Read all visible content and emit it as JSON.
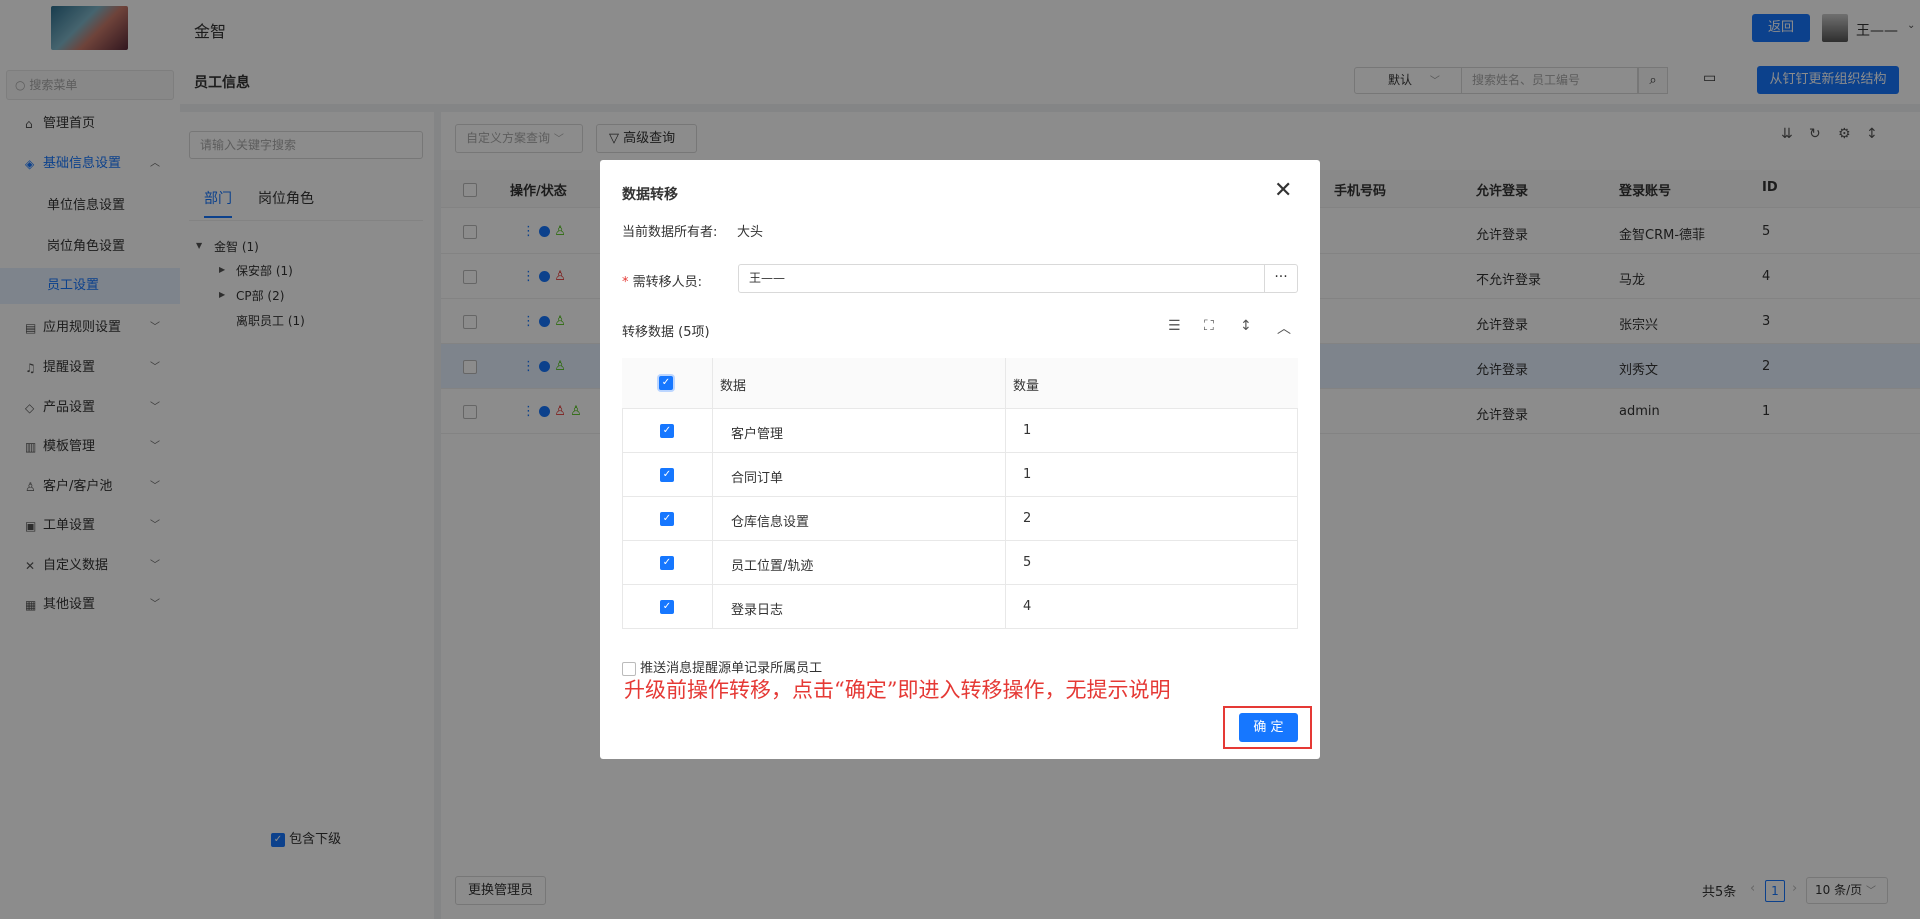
{
  "app": {
    "title": "金智",
    "back_label": "返回",
    "user_name": "王——"
  },
  "sidebar": {
    "search_placeholder": "搜索菜单",
    "items": [
      {
        "label": "管理首页",
        "icon": "home-icon",
        "glyph": "⌂"
      },
      {
        "label": "基础信息设置",
        "icon": "cube-icon",
        "glyph": "◈",
        "expanded": true
      },
      {
        "label": "应用规则设置",
        "icon": "doc-icon",
        "glyph": "▤"
      },
      {
        "label": "提醒设置",
        "icon": "bell-icon",
        "glyph": "♫"
      },
      {
        "label": "产品设置",
        "icon": "box-icon",
        "glyph": "◇"
      },
      {
        "label": "模板管理",
        "icon": "template-icon",
        "glyph": "▥"
      },
      {
        "label": "客户/客户池",
        "icon": "users-icon",
        "glyph": "♙"
      },
      {
        "label": "工单设置",
        "icon": "ticket-icon",
        "glyph": "▣"
      },
      {
        "label": "自定义数据",
        "icon": "tools-icon",
        "glyph": "✕"
      },
      {
        "label": "其他设置",
        "icon": "grid-icon",
        "glyph": "▦"
      }
    ],
    "sub_items": [
      "单位信息设置",
      "岗位角色设置",
      "员工设置"
    ]
  },
  "header": {
    "page_title": "员工信息",
    "filter_value": "默认",
    "search_placeholder": "搜索姓名、员工编号",
    "sync_label": "从钉钉更新组织结构"
  },
  "left_panel": {
    "keyword_placeholder": "请输入关键字搜索",
    "tabs": [
      "部门",
      "岗位角色"
    ],
    "tree": [
      {
        "label": "金智 (1)"
      },
      {
        "label": "保安部 (1)"
      },
      {
        "label": "CP部 (2)"
      },
      {
        "label": "离职员工 (1)"
      }
    ],
    "include_sub_label": "包含下级"
  },
  "grid": {
    "custom_query_placeholder": "自定义方案查询",
    "advanced_query_label": "高级查询",
    "columns": [
      "操作/状态",
      "手机号码",
      "允许登录",
      "登录账号",
      "ID"
    ],
    "rows": [
      {
        "login": "允许登录",
        "account": "金智CRM-德菲",
        "id": "5"
      },
      {
        "login": "不允许登录",
        "account": "马龙",
        "id": "4"
      },
      {
        "login": "允许登录",
        "account": "张宗兴",
        "id": "3"
      },
      {
        "login": "允许登录",
        "account": "刘秀文",
        "id": "2"
      },
      {
        "login": "允许登录",
        "account": "admin",
        "id": "1"
      }
    ],
    "change_admin_label": "更换管理员",
    "total_text": "共5条",
    "current_page": "1",
    "page_size": "10 条/页"
  },
  "modal": {
    "title": "数据转移",
    "owner_label": "当前数据所有者:",
    "owner_value": "大头",
    "transfer_label": "需转移人员:",
    "transfer_value": "王——",
    "section_title": "转移数据 (5项)",
    "col_data": "数据",
    "col_count": "数量",
    "rows": [
      {
        "name": "客户管理",
        "count": "1"
      },
      {
        "name": "合同订单",
        "count": "1"
      },
      {
        "name": "仓库信息设置",
        "count": "2"
      },
      {
        "name": "员工位置/轨迹",
        "count": "5"
      },
      {
        "name": "登录日志",
        "count": "4"
      }
    ],
    "push_label": "推送消息提醒源单记录所属员工",
    "confirm_label": "确 定"
  },
  "annotation": "升级前操作转移，点击“确定”即进入转移操作，无提示说明"
}
